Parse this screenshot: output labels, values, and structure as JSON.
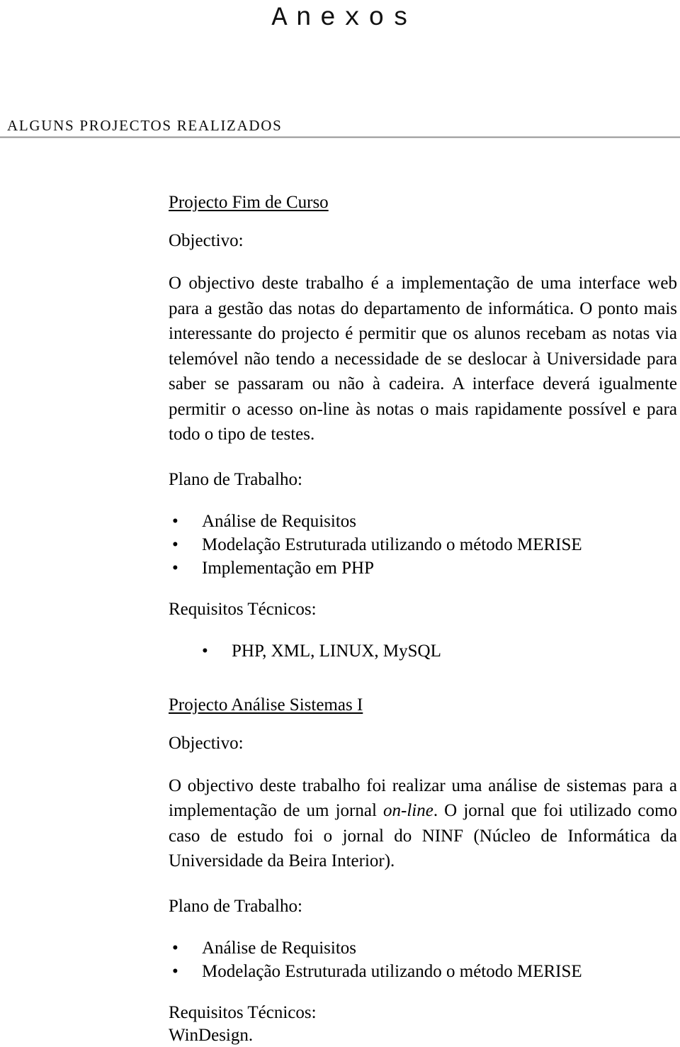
{
  "document": {
    "title": "Anexos",
    "section_heading": "ALGUNS PROJECTOS REALIZADOS"
  },
  "projects": [
    {
      "title": "Projecto Fim de Curso",
      "objective_label": "Objectivo:",
      "objective_text_part1": "O objectivo deste trabalho é a implementação de uma interface web para a gestão das notas do departamento de informática. O ponto mais interessante do projecto é permitir que os alunos recebam as notas via telemóvel não tendo a necessidade de se deslocar à Universidade para saber se passaram ou não à cadeira. A interface deverá igualmente permitir o acesso on-line às notas o mais rapidamente possível e para todo o tipo de testes.",
      "plan_label": "Plano de Trabalho:",
      "plan_items": [
        "Análise de Requisitos",
        "Modelação Estruturada utilizando o método MERISE",
        "Implementação em PHP"
      ],
      "requirements_label": "Requisitos Técnicos:",
      "requirements_items": [
        "PHP, XML, LINUX, MySQL"
      ]
    },
    {
      "title": "Projecto Análise Sistemas I",
      "objective_label": "Objectivo:",
      "objective_text_part1": "O objectivo deste trabalho foi realizar uma análise de sistemas para a implementação de um jornal ",
      "objective_emphasis": "on-line",
      "objective_text_part2": ". O jornal que foi utilizado como caso de estudo foi o jornal do NINF (Núcleo de Informática da Universidade da Beira Interior).",
      "plan_label": "Plano de Trabalho:",
      "plan_items": [
        "Análise de Requisitos",
        "Modelação Estruturada utilizando o método MERISE"
      ],
      "requirements_label": "Requisitos Técnicos:",
      "requirements_text": "WinDesign."
    }
  ],
  "symbols": {
    "bullet": "•"
  }
}
